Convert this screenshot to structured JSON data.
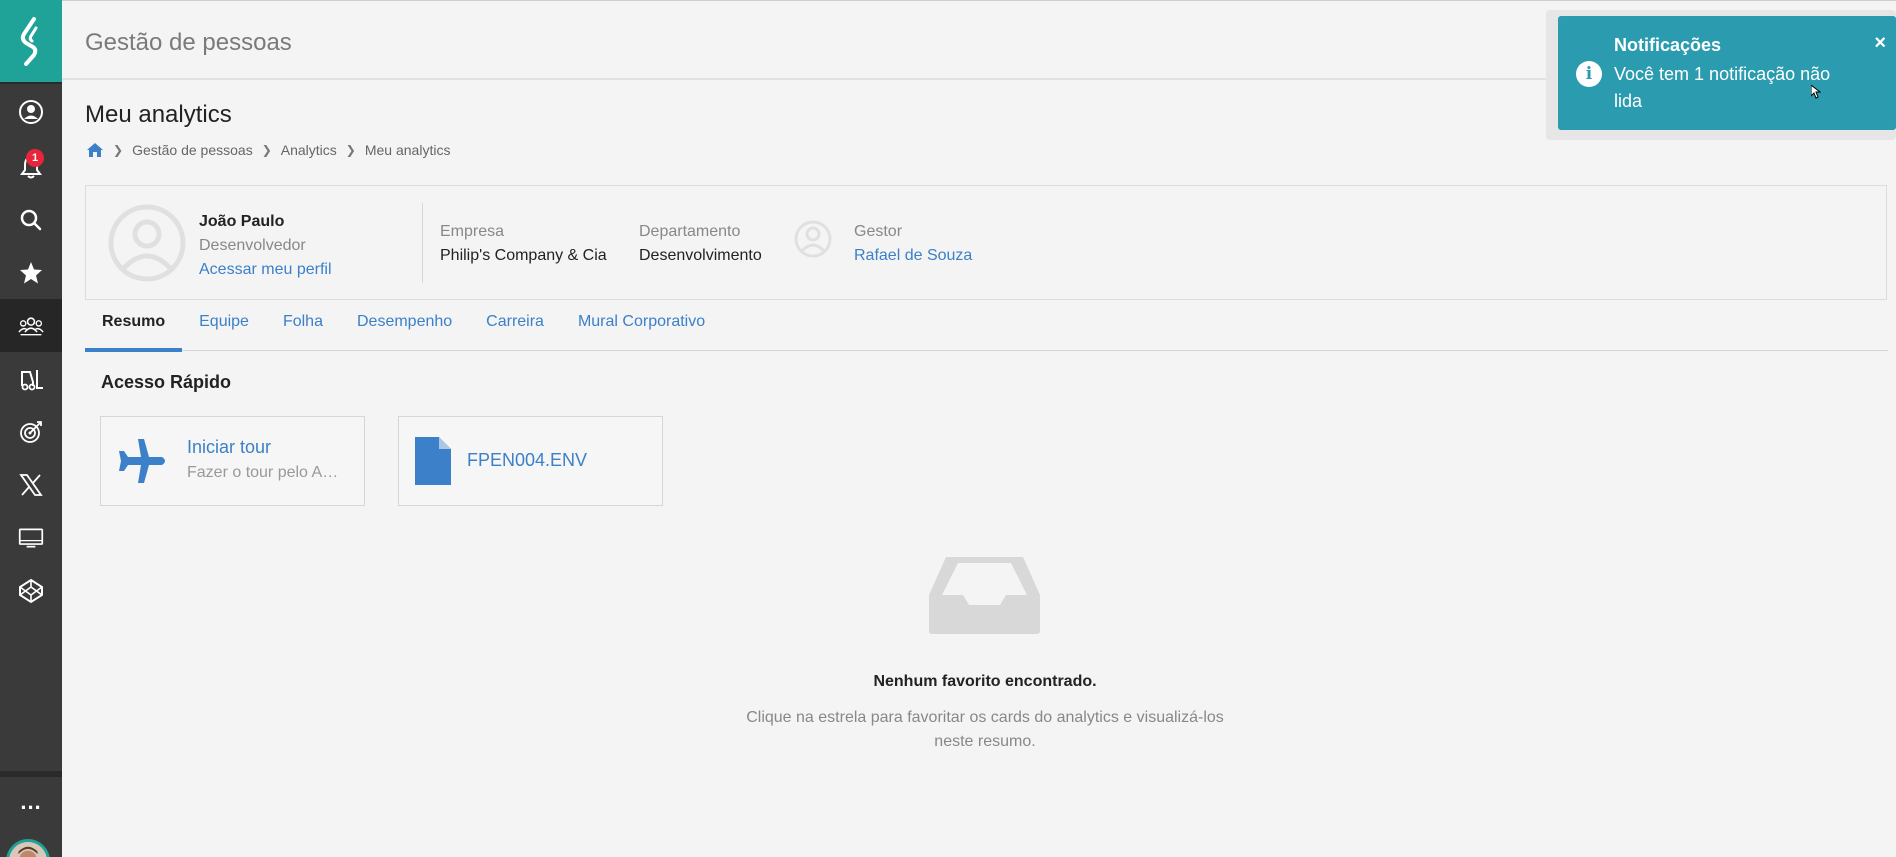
{
  "sidebar": {
    "notification_badge": "1",
    "more_label": "...",
    "items": [
      {
        "icon": "user-circle-icon"
      },
      {
        "icon": "bell-icon"
      },
      {
        "icon": "search-icon"
      },
      {
        "icon": "star-icon"
      },
      {
        "icon": "people-group-icon",
        "active": true
      },
      {
        "icon": "forklift-icon"
      },
      {
        "icon": "target-icon"
      },
      {
        "icon": "x-logo-icon"
      },
      {
        "icon": "monitor-icon"
      },
      {
        "icon": "codepen-icon"
      }
    ],
    "accent_color": "#1fa398"
  },
  "header": {
    "title": "Gestão de pessoas"
  },
  "page": {
    "title": "Meu analytics",
    "breadcrumb": [
      "Gestão de pessoas",
      "Analytics",
      "Meu analytics"
    ]
  },
  "profile": {
    "name": "João Paulo",
    "role": "Desenvolvedor",
    "profile_link": "Acessar meu perfil",
    "company_label": "Empresa",
    "company_value": "Philip's Company & Cia",
    "department_label": "Departamento",
    "department_value": "Desenvolvimento",
    "manager_label": "Gestor",
    "manager_value": "Rafael de Souza"
  },
  "tabs": [
    "Resumo",
    "Equipe",
    "Folha",
    "Desempenho",
    "Carreira",
    "Mural Corporativo"
  ],
  "quick_access": {
    "title": "Acesso Rápido",
    "cards": [
      {
        "title": "Iniciar tour",
        "subtitle": "Fazer o tour pelo Analytics",
        "icon": "plane-icon"
      },
      {
        "title": "FPEN004.ENV",
        "icon": "file-icon"
      }
    ]
  },
  "empty_state": {
    "title": "Nenhum favorito encontrado.",
    "text": "Clique na estrela para favoritar os cards do analytics e visualizá-los neste resumo."
  },
  "notification": {
    "title": "Notificações",
    "body": "Você tem 1 notificação não lida",
    "close": "×",
    "color": "#2b9cb0"
  }
}
